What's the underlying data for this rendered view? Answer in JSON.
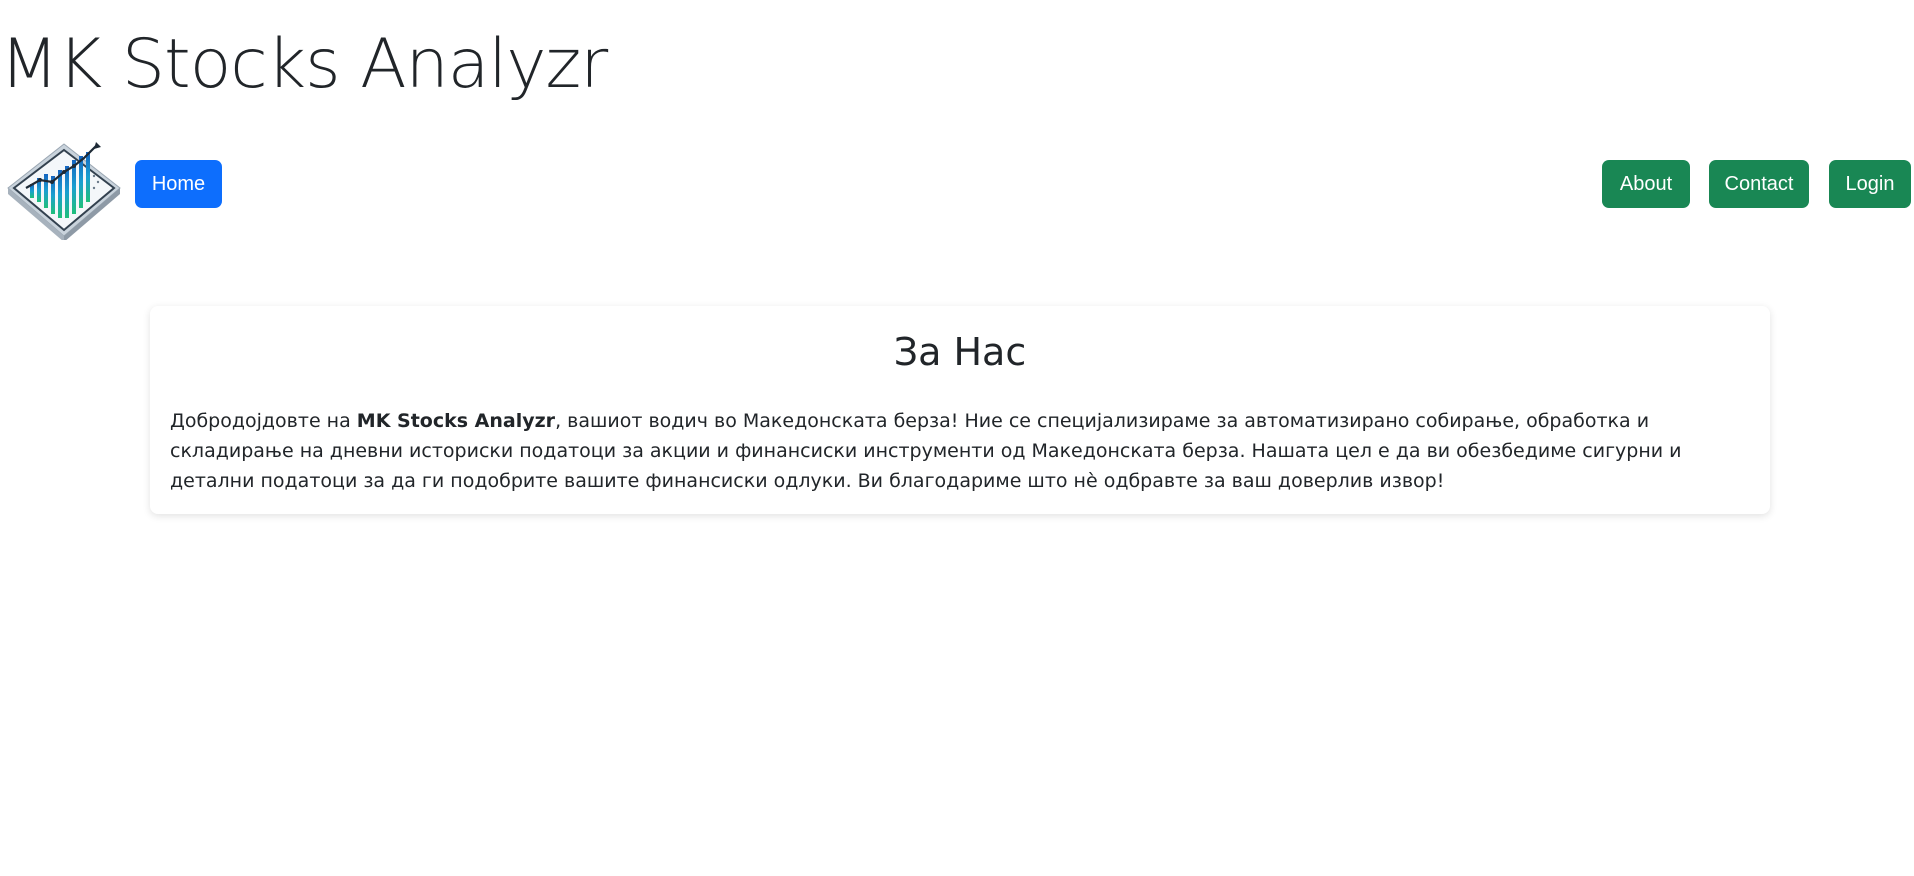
{
  "site": {
    "title": "MK Stocks Analyzr"
  },
  "nav": {
    "logo_icon": "stock-chart-logo-icon",
    "home_label": "Home",
    "about_label": "About",
    "contact_label": "Contact",
    "login_label": "Login"
  },
  "about": {
    "heading": "За Нас",
    "intro_before": "Добродојдовте на ",
    "brand": "MK Stocks Analyzr",
    "intro_after": ", вашиот водич во Македонската берза! Ние се специјализираме за автоматизирано собирање, обработка и складирање на дневни историски податоци за акции и финансиски инструменти од Македонската берза. Нашата цел е да ви обезбедиме сигурни и детални податоци за да ги подобрите вашите финансиски одлуки. Ви благодариме што нè одбравте за ваш доверлив извор!"
  },
  "colors": {
    "primary": "#0d6efd",
    "success": "#198754",
    "text": "#212529",
    "background": "#ffffff"
  }
}
